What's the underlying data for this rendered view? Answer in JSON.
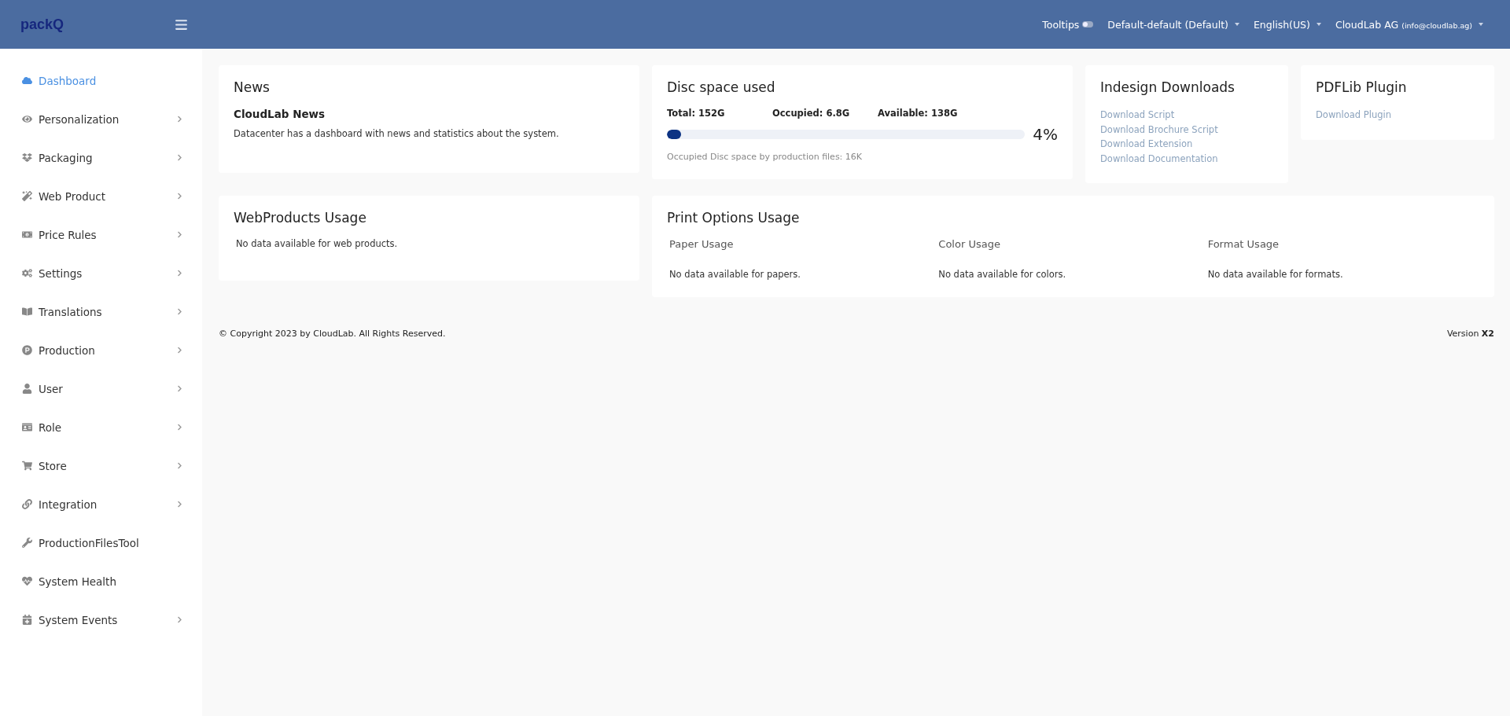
{
  "header": {
    "logo": "packQ",
    "tooltips": {
      "label": "Tooltips",
      "on": false
    },
    "menus": [
      {
        "label": "Default-default (Default)"
      },
      {
        "label": "English(US)"
      },
      {
        "label": "CloudLab AG",
        "sub": "(info@cloudlab.ag)"
      }
    ]
  },
  "sidebar": {
    "items": [
      {
        "label": "Dashboard",
        "selected": true,
        "expandable": false
      },
      {
        "label": "Personalization",
        "selected": false,
        "expandable": true
      },
      {
        "label": "Packaging",
        "selected": false,
        "expandable": true
      },
      {
        "label": "Web Product",
        "selected": false,
        "expandable": true
      },
      {
        "label": "Price Rules",
        "selected": false,
        "expandable": true
      },
      {
        "label": "Settings",
        "selected": false,
        "expandable": true
      },
      {
        "label": "Translations",
        "selected": false,
        "expandable": true
      },
      {
        "label": "Production",
        "selected": false,
        "expandable": true
      },
      {
        "label": "User",
        "selected": false,
        "expandable": true
      },
      {
        "label": "Role",
        "selected": false,
        "expandable": true
      },
      {
        "label": "Store",
        "selected": false,
        "expandable": true
      },
      {
        "label": "Integration",
        "selected": false,
        "expandable": true
      },
      {
        "label": "ProductionFilesTool",
        "selected": false,
        "expandable": false
      },
      {
        "label": "System Health",
        "selected": false,
        "expandable": false
      },
      {
        "label": "System Events",
        "selected": false,
        "expandable": true
      }
    ]
  },
  "news": {
    "title": "News",
    "heading": "CloudLab News",
    "text": "Datacenter has a dashboard with news and statistics about the system."
  },
  "disc": {
    "title": "Disc space used",
    "stats": [
      "Total: 152G",
      "Occupied: 6.8G",
      "Available: 138G"
    ],
    "level": 0.04,
    "percent": "4%",
    "note": "Occupied Disc space by production files: 16K"
  },
  "indesign": {
    "title": "Indesign Downloads",
    "links": [
      "Download Script",
      "Download Brochure Script",
      "Download Extension",
      "Download Documentation"
    ]
  },
  "pdflib": {
    "title": "PDFLib Plugin",
    "links": [
      "Download Plugin"
    ]
  },
  "webproducts": {
    "title": "WebProducts Usage",
    "text": "No data available for web products."
  },
  "print": {
    "title": "Print Options Usage",
    "columns": [
      {
        "heading": "Paper Usage",
        "text": "No data available for papers."
      },
      {
        "heading": "Color Usage",
        "text": "No data available for colors."
      },
      {
        "heading": "Format Usage",
        "text": "No data available for formats."
      }
    ]
  },
  "footer": {
    "copyright": "© Copyright 2023 by CloudLab. All Rights Reserved.",
    "version_label": "Version",
    "version": "X2"
  }
}
